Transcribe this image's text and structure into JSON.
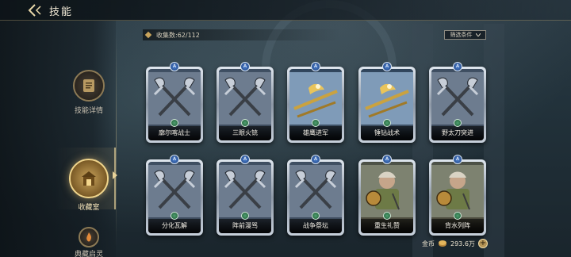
{
  "header": {
    "title": "技能"
  },
  "sidebar": {
    "items": [
      {
        "label": "技能详情",
        "icon": "scroll-icon",
        "active": false
      },
      {
        "label": "收藏室",
        "icon": "vault-icon",
        "active": true
      },
      {
        "label": "典藏启灵",
        "icon": "flame-icon",
        "active": false
      }
    ]
  },
  "collection": {
    "label": "收集数:62/112"
  },
  "filter": {
    "label": "筛选条件"
  },
  "cards": [
    {
      "name": "廓尔喀战士",
      "art": "crossed-axes"
    },
    {
      "name": "三眼火铳",
      "art": "crossed-axes"
    },
    {
      "name": "雄鹰进军",
      "art": "golden-spear"
    },
    {
      "name": "锤钻战术",
      "art": "golden-spear"
    },
    {
      "name": "野太刀突进",
      "art": "crossed-axes"
    },
    {
      "name": "分化瓦解",
      "art": "crossed-axes"
    },
    {
      "name": "阵前漫骂",
      "art": "crossed-axes"
    },
    {
      "name": "战争祭坛",
      "art": "crossed-axes"
    },
    {
      "name": "重生礼赞",
      "art": "warrior"
    },
    {
      "name": "背水列阵",
      "art": "warrior"
    }
  ],
  "currency": {
    "label": "金币",
    "value": "293.6万"
  },
  "colors": {
    "accent": "#c9a45c",
    "card_frame": "#dfe6ee"
  }
}
